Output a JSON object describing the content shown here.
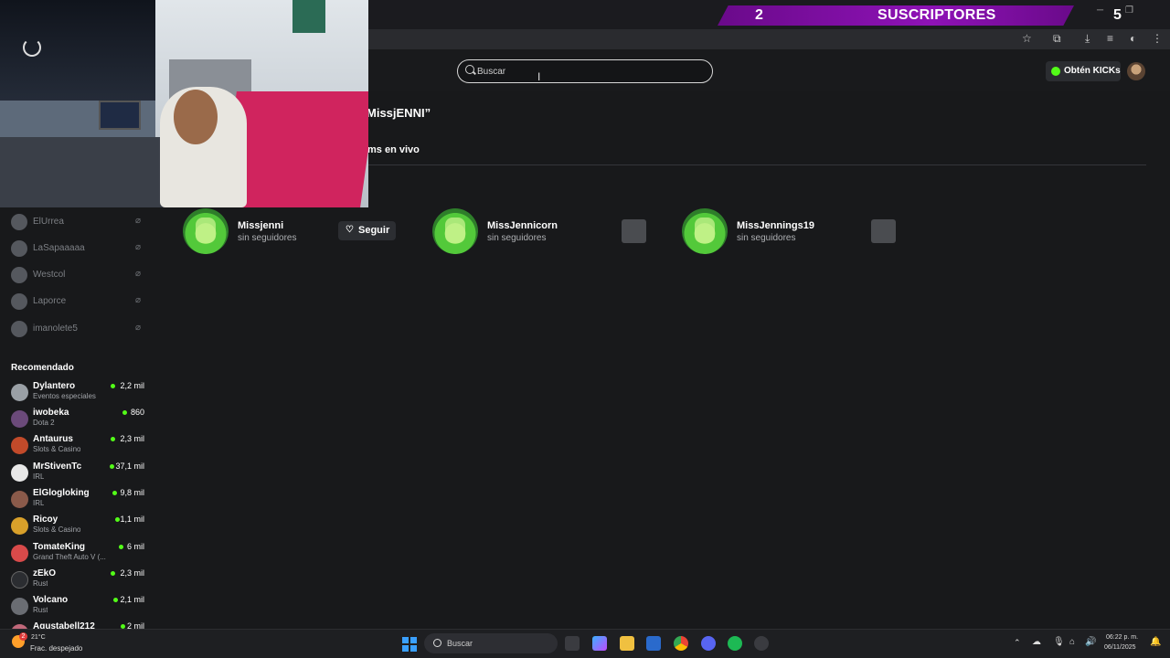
{
  "overlay": {
    "subscriber_count": "2",
    "subscriber_label": "SUSCRIPTORES",
    "right_number": "5"
  },
  "header": {
    "search_placeholder": "Buscar",
    "kicks_button": "Obtén KICKs"
  },
  "results": {
    "title": "MissjENNI”",
    "tab_live": "ms en vivo",
    "channels": [
      {
        "name": "Missjenni",
        "followers": "sin seguidores",
        "follow_label": "Seguir"
      },
      {
        "name": "MissJennicorn",
        "followers": "sin seguidores"
      },
      {
        "name": "MissJennings19",
        "followers": "sin seguidores"
      }
    ]
  },
  "sidebar": {
    "following": [
      {
        "name": "ElUrrea"
      },
      {
        "name": "LaSapaaaaa"
      },
      {
        "name": "Westcol"
      },
      {
        "name": "Laporce"
      },
      {
        "name": "imanolete5"
      }
    ],
    "recommended_title": "Recomendado",
    "recommended": [
      {
        "name": "Dylantero",
        "category": "Eventos especiales",
        "viewers": "2,2 mil",
        "color": "#9aa0a6"
      },
      {
        "name": "iwobeka",
        "category": "Dota 2",
        "viewers": "860",
        "color": "#6b4a7a"
      },
      {
        "name": "Antaurus",
        "category": "Slots & Casino",
        "viewers": "2,3 mil",
        "color": "#c24a2a"
      },
      {
        "name": "MrStivenTc",
        "category": "IRL",
        "viewers": "37,1 mil",
        "color": "#e8e8e8"
      },
      {
        "name": "ElGlogloking",
        "category": "IRL",
        "viewers": "9,8 mil",
        "color": "#8a5a4a"
      },
      {
        "name": "Ricoy",
        "category": "Slots & Casino",
        "viewers": "1,1 mil",
        "color": "#d8a02a"
      },
      {
        "name": "TomateKing",
        "category": "Grand Theft Auto V (...",
        "viewers": "6 mil",
        "color": "#d84a4a"
      },
      {
        "name": "zEkO",
        "category": "Rust",
        "viewers": "2,3 mil",
        "color": "#2b2d31"
      },
      {
        "name": "Volcano",
        "category": "Rust",
        "viewers": "2,1 mil",
        "color": "#6a6d73"
      },
      {
        "name": "Agustabell212",
        "category": "",
        "viewers": "2 mil",
        "color": "#c0687a"
      }
    ]
  },
  "taskbar": {
    "weather_temp": "21°C",
    "weather_desc": "Frac. despejado",
    "weather_badge": "2",
    "search_label": "Buscar",
    "clock_time": "06:22 p. m.",
    "clock_date": "06/11/2025"
  },
  "colors": {
    "accent_green": "#53fc18",
    "banner_purple": "#8e12b6",
    "background": "#18191b"
  }
}
